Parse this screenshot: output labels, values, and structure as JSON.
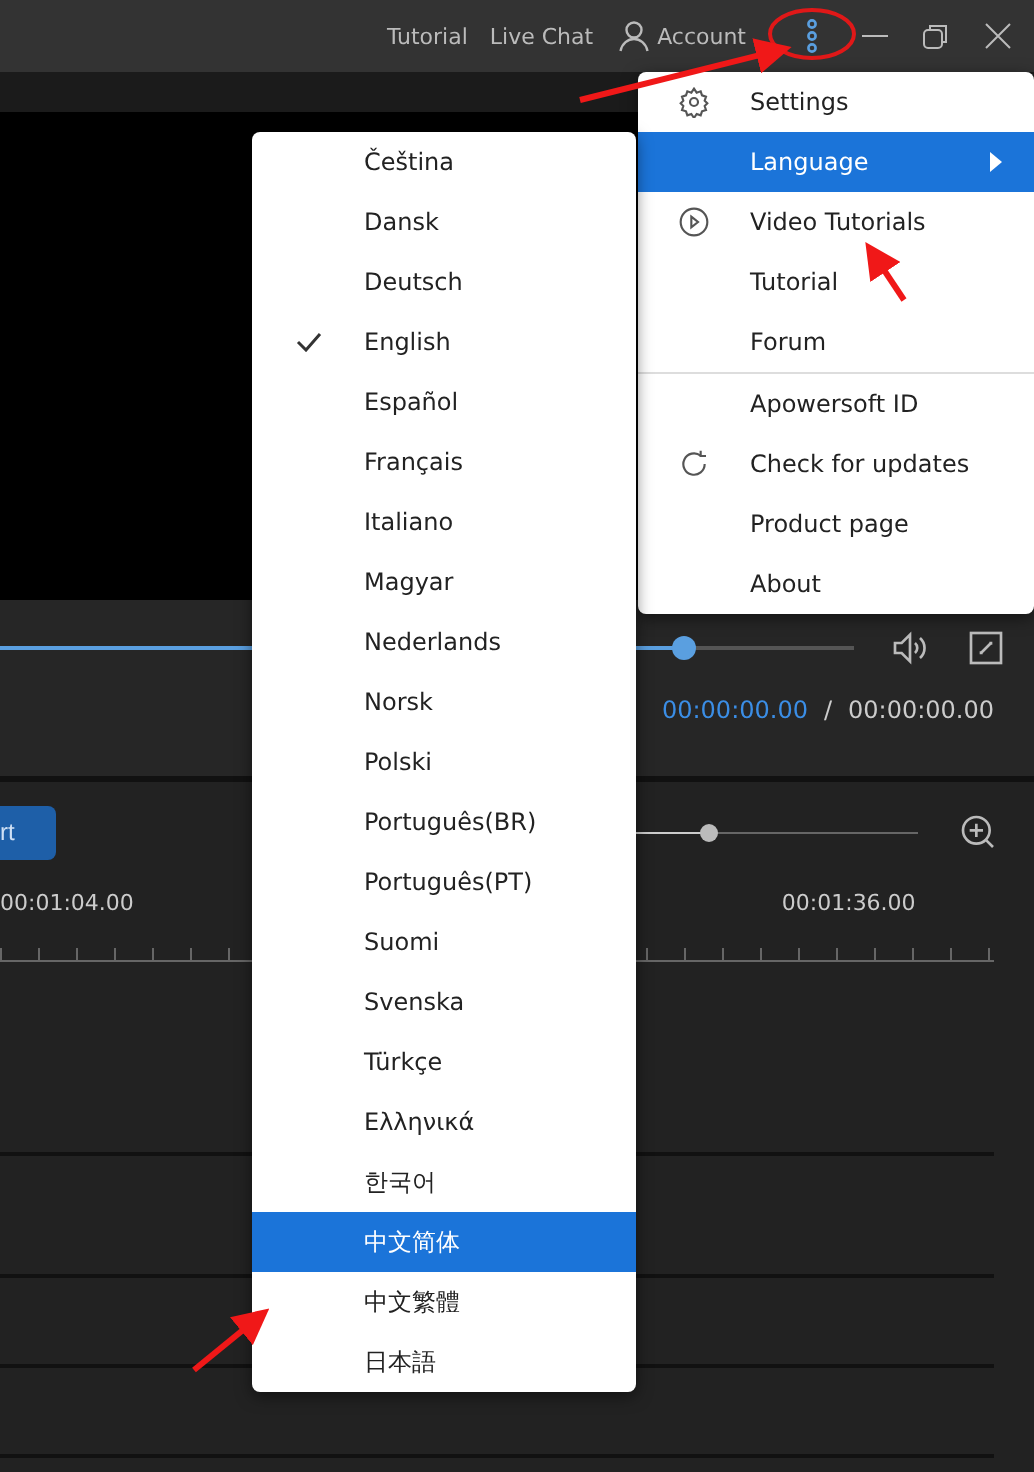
{
  "title_bar": {
    "links": [
      "Tutorial",
      "Live Chat"
    ],
    "account": "Account"
  },
  "player": {
    "level": 0.8,
    "current_time": "00:00:00.00",
    "separator": "/",
    "total_time": "00:00:00.00"
  },
  "timeline": {
    "button": "rt",
    "zoom": {
      "level": 0.28
    },
    "ruler": [
      "00:01:04.00",
      "00:01:36.00"
    ]
  },
  "main_menu": {
    "sections": [
      [
        {
          "label": "Settings",
          "selected": false,
          "submenu": false
        },
        {
          "label": "Language",
          "selected": true,
          "submenu": true
        },
        {
          "label": "Video Tutorials",
          "selected": false,
          "submenu": false
        },
        {
          "label": "Tutorial",
          "selected": false,
          "submenu": false
        },
        {
          "label": "Forum",
          "selected": false,
          "submenu": false
        }
      ],
      [
        {
          "label": "Apowersoft ID",
          "selected": false,
          "submenu": false
        },
        {
          "label": "Check for updates",
          "selected": false,
          "submenu": false
        },
        {
          "label": "Product page",
          "selected": false,
          "submenu": false
        },
        {
          "label": "About",
          "selected": false,
          "submenu": false
        }
      ]
    ]
  },
  "language_menu": [
    {
      "label": "Čeština",
      "checked": false,
      "selected": false
    },
    {
      "label": "Dansk",
      "checked": false,
      "selected": false
    },
    {
      "label": "Deutsch",
      "checked": false,
      "selected": false
    },
    {
      "label": "English",
      "checked": true,
      "selected": false
    },
    {
      "label": "Español",
      "checked": false,
      "selected": false
    },
    {
      "label": "Français",
      "checked": false,
      "selected": false
    },
    {
      "label": "Italiano",
      "checked": false,
      "selected": false
    },
    {
      "label": "Magyar",
      "checked": false,
      "selected": false
    },
    {
      "label": "Nederlands",
      "checked": false,
      "selected": false
    },
    {
      "label": "Norsk",
      "checked": false,
      "selected": false
    },
    {
      "label": "Polski",
      "checked": false,
      "selected": false
    },
    {
      "label": "Português(BR)",
      "checked": false,
      "selected": false
    },
    {
      "label": "Português(PT)",
      "checked": false,
      "selected": false
    },
    {
      "label": "Suomi",
      "checked": false,
      "selected": false
    },
    {
      "label": "Svenska",
      "checked": false,
      "selected": false
    },
    {
      "label": "Türkçe",
      "checked": false,
      "selected": false
    },
    {
      "label": "Ελληνικά",
      "checked": false,
      "selected": false
    },
    {
      "label": "한국어",
      "checked": false,
      "selected": false
    },
    {
      "label": "中文简体",
      "checked": false,
      "selected": true
    },
    {
      "label": "中文繁體",
      "checked": false,
      "selected": false
    },
    {
      "label": "日本語",
      "checked": false,
      "selected": false
    }
  ]
}
